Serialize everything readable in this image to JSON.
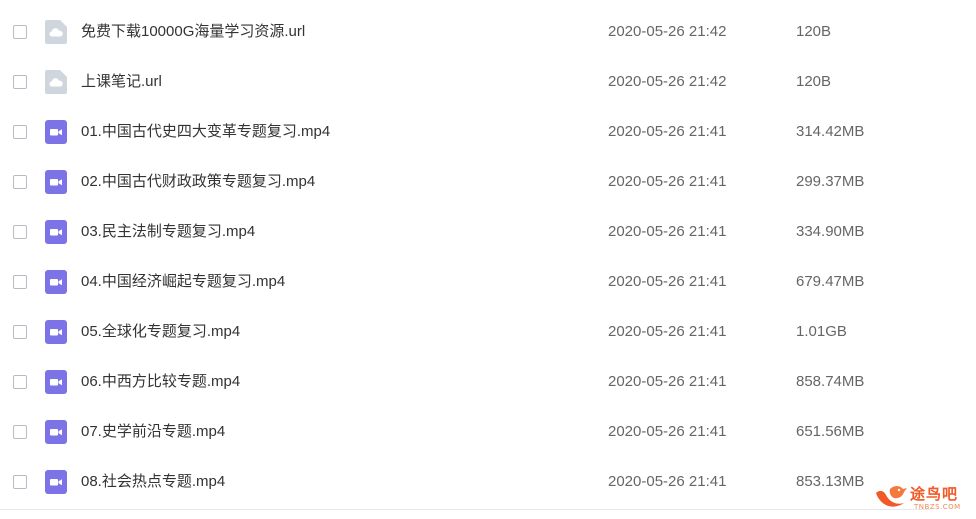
{
  "files": [
    {
      "name": "免费下载10000G海量学习资源.url",
      "date": "2020-05-26 21:42",
      "size": "120B",
      "type": "link-icon"
    },
    {
      "name": "上课笔记.url",
      "date": "2020-05-26 21:42",
      "size": "120B",
      "type": "link-icon"
    },
    {
      "name": "01.中国古代史四大变革专题复习.mp4",
      "date": "2020-05-26 21:41",
      "size": "314.42MB",
      "type": "video-icon"
    },
    {
      "name": "02.中国古代财政政策专题复习.mp4",
      "date": "2020-05-26 21:41",
      "size": "299.37MB",
      "type": "video-icon"
    },
    {
      "name": "03.民主法制专题复习.mp4",
      "date": "2020-05-26 21:41",
      "size": "334.90MB",
      "type": "video-icon"
    },
    {
      "name": "04.中国经济崛起专题复习.mp4",
      "date": "2020-05-26 21:41",
      "size": "679.47MB",
      "type": "video-icon"
    },
    {
      "name": "05.全球化专题复习.mp4",
      "date": "2020-05-26 21:41",
      "size": "1.01GB",
      "type": "video-icon"
    },
    {
      "name": "06.中西方比较专题.mp4",
      "date": "2020-05-26 21:41",
      "size": "858.74MB",
      "type": "video-icon"
    },
    {
      "name": "07.史学前沿专题.mp4",
      "date": "2020-05-26 21:41",
      "size": "651.56MB",
      "type": "video-icon"
    },
    {
      "name": "08.社会热点专题.mp4",
      "date": "2020-05-26 21:41",
      "size": "853.13MB",
      "type": "video-icon"
    }
  ],
  "watermark": {
    "text": "途鸟吧",
    "sub": "TNBZS.COM"
  },
  "colors": {
    "video_icon": "#7b73e6",
    "link_icon": "#cfd6dd",
    "watermark": "#f05a28"
  }
}
